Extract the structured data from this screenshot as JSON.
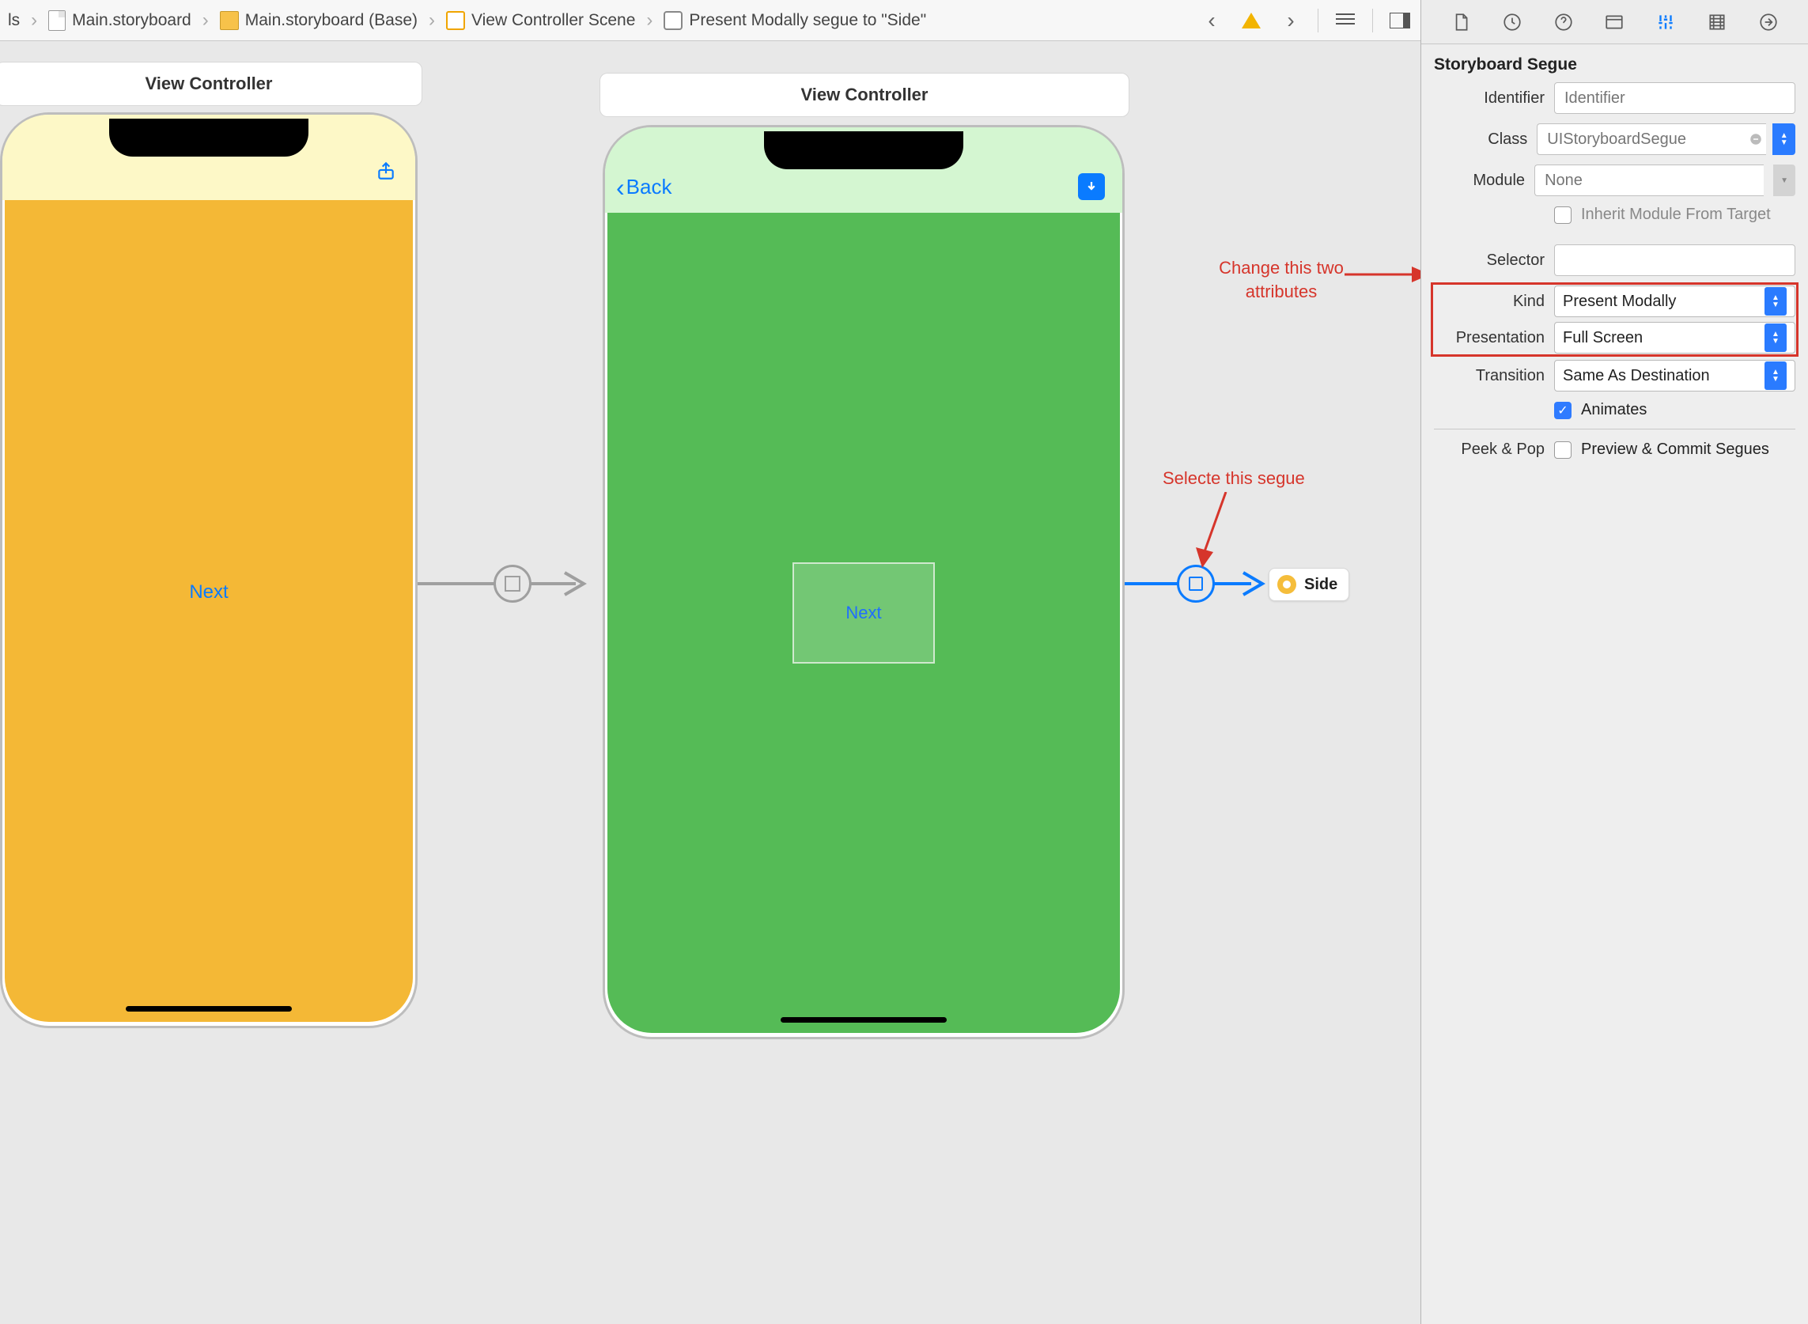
{
  "breadcrumb": {
    "items": [
      "ls",
      "Main.storyboard",
      "Main.storyboard (Base)",
      "View Controller Scene",
      "Present Modally segue to \"Side\""
    ]
  },
  "canvas": {
    "scene1": {
      "title": "View Controller",
      "next_label": "Next"
    },
    "scene2": {
      "title": "View Controller",
      "back_label": "Back",
      "container_label": "Next"
    },
    "side_chip": "Side"
  },
  "annotations": {
    "attrs_line1": "Change this two",
    "attrs_line2": "attributes",
    "segue": "Selecte this segue"
  },
  "inspector": {
    "section": "Storyboard Segue",
    "labels": {
      "identifier": "Identifier",
      "klass": "Class",
      "module": "Module",
      "inherit": "Inherit Module From Target",
      "selector": "Selector",
      "kind": "Kind",
      "presentation": "Presentation",
      "transition": "Transition",
      "animates": "Animates",
      "peekpop": "Peek & Pop",
      "preview": "Preview & Commit Segues"
    },
    "values": {
      "identifier_placeholder": "Identifier",
      "klass_placeholder": "UIStoryboardSegue",
      "module_placeholder": "None",
      "kind": "Present Modally",
      "presentation": "Full Screen",
      "transition": "Same As Destination"
    }
  }
}
